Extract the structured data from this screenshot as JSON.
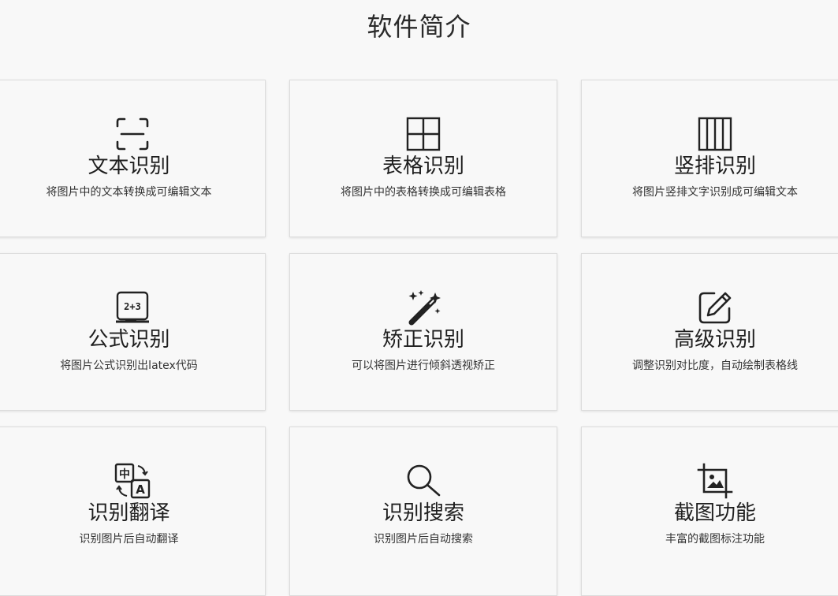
{
  "page": {
    "title": "软件简介"
  },
  "cards": [
    {
      "title": "文本识别",
      "desc": "将图片中的文本转换成可编辑文本",
      "icon": "text-scan-icon"
    },
    {
      "title": "表格识别",
      "desc": "将图片中的表格转换成可编辑表格",
      "icon": "table-grid-icon"
    },
    {
      "title": "竖排识别",
      "desc": "将图片竖排文字识别成可编辑文本",
      "icon": "vertical-columns-icon"
    },
    {
      "title": "公式识别",
      "desc": "将图片公式识别出latex代码",
      "icon": "formula-board-icon",
      "icon_text": "2+3"
    },
    {
      "title": "矫正识别",
      "desc": "可以将图片进行倾斜透视矫正",
      "icon": "magic-wand-icon"
    },
    {
      "title": "高级识别",
      "desc": "调整识别对比度，自动绘制表格线",
      "icon": "edit-square-icon"
    },
    {
      "title": "识别翻译",
      "desc": "识别图片后自动翻译",
      "icon": "translate-icon",
      "icon_text_a": "中",
      "icon_text_b": "A"
    },
    {
      "title": "识别搜索",
      "desc": "识别图片后自动搜索",
      "icon": "search-icon"
    },
    {
      "title": "截图功能",
      "desc": "丰富的截图标注功能",
      "icon": "crop-image-icon"
    }
  ],
  "colors": {
    "background": "#f8f8f8",
    "card_border": "#dcdcdc",
    "text": "#1f1f1f",
    "icon": "#222222"
  }
}
